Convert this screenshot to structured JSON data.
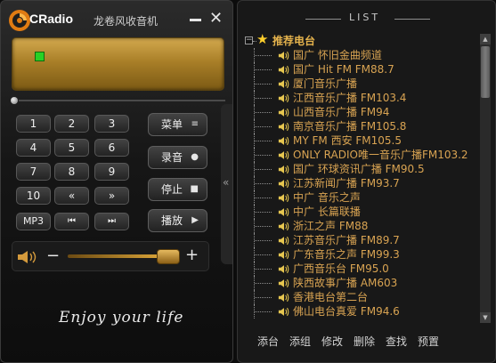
{
  "left": {
    "app_name": "CRadio",
    "title": "龙卷风收音机",
    "close_glyph": "✕",
    "keypad": [
      "1",
      "2",
      "3",
      "4",
      "5",
      "6",
      "7",
      "8",
      "9",
      "10",
      "«",
      "»",
      "MP3",
      "⏮",
      "⏭"
    ],
    "functions": [
      {
        "label": "菜单",
        "icon": "≡"
      },
      {
        "label": "录音",
        "icon": "●"
      },
      {
        "label": "停止",
        "icon": "■"
      },
      {
        "label": "播放",
        "icon": "▶"
      }
    ],
    "volume": {
      "level": 0.92,
      "minus": "−",
      "plus": "+"
    },
    "slogan": "Enjoy your life",
    "collapse_glyph": "«"
  },
  "list": {
    "title": "LIST",
    "group": {
      "label": "推荐电台",
      "expander": "−"
    },
    "stations": [
      "国广 怀旧金曲频道",
      "国广 Hit FM FM88.7",
      "厦门音乐广播",
      "江西音乐广播 FM103.4",
      "山西音乐广播 FM94",
      "南京音乐广播 FM105.8",
      "MY FM 西安 FM105.5",
      "ONLY RADIO唯一音乐广播FM103.2",
      "国广 环球资讯广播 FM90.5",
      "江苏新闻广播 FM93.7",
      "中广 音乐之声",
      "中广 长篇联播",
      "浙江之声 FM88",
      "江苏音乐广播 FM89.7",
      "广东音乐之声 FM99.3",
      "广西音乐台 FM95.0",
      "陕西故事广播 AM603",
      "香港电台第二台",
      "佛山电台真爱 FM94.6"
    ],
    "actions": [
      "添台",
      "添组",
      "修改",
      "删除",
      "查找",
      "预置"
    ]
  },
  "colors": {
    "accent": "#d8a352",
    "display": "#b88c32",
    "signal": "#29d125",
    "star": "#ffcf2c"
  }
}
